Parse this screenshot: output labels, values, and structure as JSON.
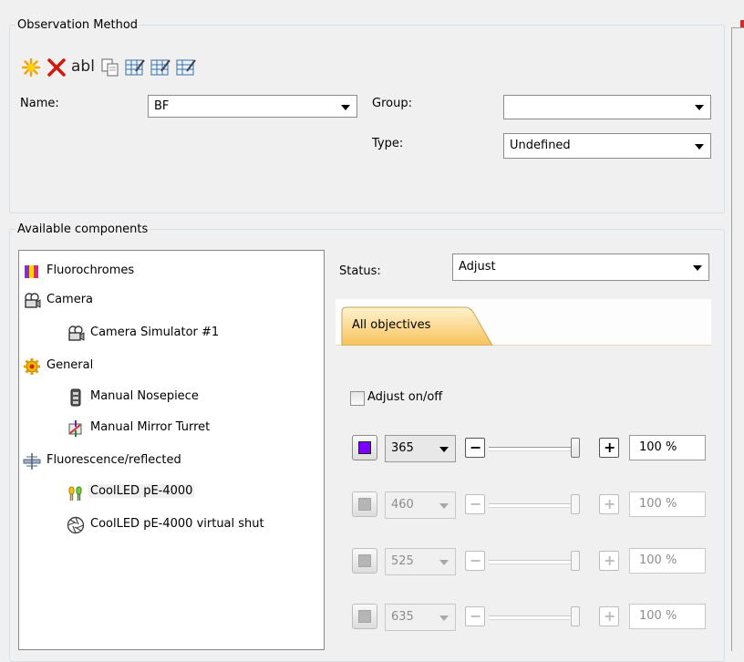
{
  "observation_method": {
    "legend": "Observation Method",
    "toolbar": {
      "new_icon": "sparkle-icon",
      "delete_icon": "red-x-icon",
      "rename_label": "abl",
      "copy_icon": "copy-icon",
      "edit1_icon": "grid-edit-icon",
      "edit2_icon": "grid-edit-icon",
      "edit3_icon": "grid-edit-icon"
    },
    "name_label": "Name:",
    "name_value": "BF",
    "group_label": "Group:",
    "group_value": "",
    "type_label": "Type:",
    "type_value": "Undefined"
  },
  "available_components": {
    "legend": "Available components",
    "tree": [
      {
        "label": "Fluorochromes",
        "icon": "fluorochromes-icon",
        "level": 0
      },
      {
        "label": "Camera",
        "icon": "camera-icon",
        "level": 0
      },
      {
        "label": "Camera Simulator #1",
        "icon": "camera-icon",
        "level": 1
      },
      {
        "label": "General",
        "icon": "gear-icon",
        "level": 0
      },
      {
        "label": "Manual Nosepiece",
        "icon": "nosepiece-icon",
        "level": 1
      },
      {
        "label": "Manual Mirror Turret",
        "icon": "mirror-turret-icon",
        "level": 1
      },
      {
        "label": "Fluorescence/reflected",
        "icon": "fluorescence-icon",
        "level": 0
      },
      {
        "label": "CoolLED pE-4000",
        "icon": "led-icon",
        "level": 1,
        "selected": true
      },
      {
        "label": "CoolLED pE-4000 virtual shut",
        "icon": "shutter-icon",
        "level": 1
      }
    ]
  },
  "right_panel": {
    "status_label": "Status:",
    "status_value": "Adjust",
    "tab_label": "All objectives",
    "adjust_label": "Adjust on/off",
    "adjust_checked": false,
    "channels": [
      {
        "wavelength": "365",
        "percent": "100 %",
        "enabled": true,
        "swatch_color": "#7a00ff",
        "level": 1.0
      },
      {
        "wavelength": "460",
        "percent": "100 %",
        "enabled": false,
        "swatch_color": "#b5b5b5",
        "level": 1.0
      },
      {
        "wavelength": "525",
        "percent": "100 %",
        "enabled": false,
        "swatch_color": "#b5b5b5",
        "level": 1.0
      },
      {
        "wavelength": "635",
        "percent": "100 %",
        "enabled": false,
        "swatch_color": "#b5b5b5",
        "level": 1.0
      }
    ],
    "minus_symbol": "−",
    "plus_symbol": "+"
  }
}
